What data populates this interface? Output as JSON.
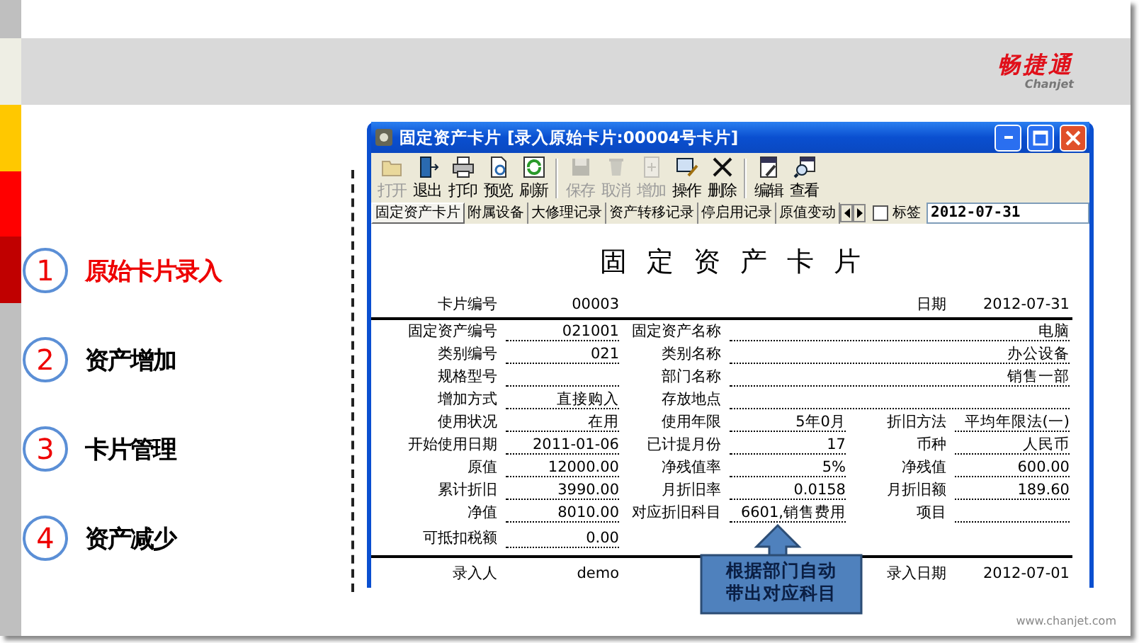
{
  "header": {
    "logo_name": "畅捷通",
    "logo_subtitle": "Chanjet"
  },
  "steps": [
    {
      "number": "1",
      "label": "原始卡片录入",
      "selected": true
    },
    {
      "number": "2",
      "label": "资产增加",
      "selected": false
    },
    {
      "number": "3",
      "label": "卡片管理",
      "selected": false
    },
    {
      "number": "4",
      "label": "资产减少",
      "selected": false
    }
  ],
  "window": {
    "title": "固定资产卡片 [录入原始卡片:00004号卡片]",
    "toolbar": [
      {
        "label": "打开",
        "disabled": true
      },
      {
        "label": "退出",
        "disabled": false
      },
      {
        "label": "打印",
        "disabled": false
      },
      {
        "label": "预览",
        "disabled": false
      },
      {
        "label": "刷新",
        "disabled": false
      },
      {
        "label": "保存",
        "disabled": true
      },
      {
        "label": "取消",
        "disabled": true
      },
      {
        "label": "增加",
        "disabled": true
      },
      {
        "label": "操作",
        "disabled": false
      },
      {
        "label": "删除",
        "disabled": false
      },
      {
        "label": "编辑",
        "disabled": false
      },
      {
        "label": "查看",
        "disabled": false
      }
    ],
    "tabs": [
      {
        "label": "固定资产卡片",
        "selected": true
      },
      {
        "label": "附属设备",
        "selected": false
      },
      {
        "label": "大修理记录",
        "selected": false
      },
      {
        "label": "资产转移记录",
        "selected": false
      },
      {
        "label": "停启用记录",
        "selected": false
      },
      {
        "label": "原值变动",
        "selected": false
      }
    ],
    "tag_checkbox": {
      "label": "标签",
      "checked": false
    },
    "date_field": {
      "value": "2012-07-31"
    },
    "card": {
      "title": "固定资产卡片",
      "card_number": {
        "label": "卡片编号",
        "value": "00003"
      },
      "date": {
        "label": "日期",
        "value": "2012-07-31"
      },
      "rows": [
        [
          {
            "label": "固定资产编号",
            "value": "021001"
          },
          {
            "label": "固定资产名称",
            "value": "电脑"
          }
        ],
        [
          {
            "label": "类别编号",
            "value": "021"
          },
          {
            "label": "类别名称",
            "value": "办公设备"
          }
        ],
        [
          {
            "label": "规格型号"
          },
          {
            "label": "部门名称",
            "value": "销售一部"
          }
        ],
        [
          {
            "label": "增加方式",
            "value": "直接购入"
          },
          {
            "label": "存放地点"
          }
        ],
        [
          {
            "label": "使用状况",
            "value": "在用"
          },
          {
            "label": "使用年限",
            "value": "5年0月"
          },
          {
            "label": "折旧方法",
            "value": "平均年限法(一)"
          }
        ],
        [
          {
            "label": "开始使用日期",
            "value": "2011-01-06"
          },
          {
            "label": "已计提月份",
            "value": "17"
          },
          {
            "label": "币种",
            "value": "人民币"
          }
        ],
        [
          {
            "label": "原值",
            "value": "12000.00"
          },
          {
            "label": "净残值率",
            "value": "5%"
          },
          {
            "label": "净残值",
            "value": "600.00"
          }
        ],
        [
          {
            "label": "累计折旧",
            "value": "3990.00"
          },
          {
            "label": "月折旧率",
            "value": "0.0158"
          },
          {
            "label": "月折旧额",
            "value": "189.60"
          }
        ],
        [
          {
            "label": "净值",
            "value": "8010.00"
          },
          {
            "label": "对应折旧科目",
            "value": "6601,销售费用"
          },
          {
            "label": "项目"
          }
        ],
        [
          {
            "label": "可抵扣税额",
            "value": "0.00"
          }
        ]
      ],
      "footer": [
        {
          "label": "录入人",
          "value": "demo"
        },
        {
          "label": "录入日期",
          "value": "2012-07-01"
        }
      ]
    }
  },
  "callout": {
    "text": "根据部门自动带出对应科目"
  },
  "footer_url": "www.chanjet.com"
}
